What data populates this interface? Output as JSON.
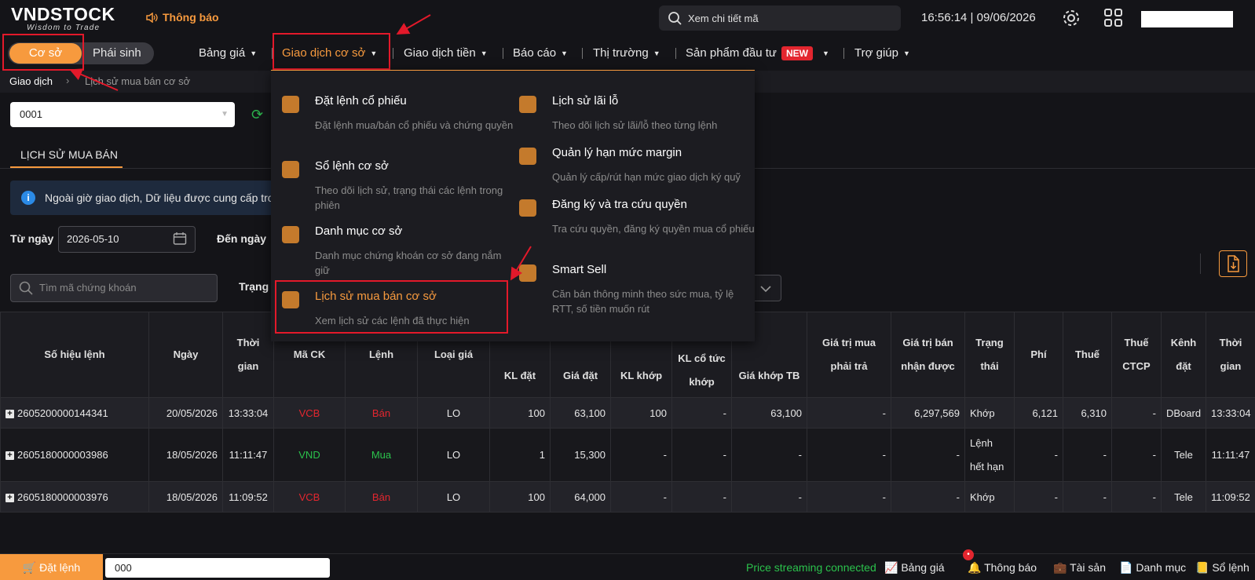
{
  "header": {
    "logo": "VNDSTOCK",
    "tagline": "Wisdom to Trade",
    "notice": "Thông báo",
    "search_placeholder": "Xem chi tiết mã",
    "clock": "16:56:14 | 09/06/2026"
  },
  "segment": {
    "active": "Cơ sở",
    "other": "Phái sinh"
  },
  "nav": {
    "items": [
      "Bảng giá",
      "Giao dịch cơ sở",
      "Giao dịch tiền",
      "Báo cáo",
      "Thị trường",
      "Sản phẩm đầu tư",
      "Trợ giúp"
    ],
    "new_badge": "NEW"
  },
  "breadcrumb": {
    "root": "Giao dịch",
    "current": "Lịch sử mua bán cơ sở"
  },
  "account": {
    "value": "0001"
  },
  "tab": {
    "label": "LỊCH SỬ MUA BÁN"
  },
  "info": {
    "text": "Ngoài giờ giao dịch, Dữ liệu được cung cấp trong"
  },
  "filters": {
    "from_label": "Từ ngày",
    "from_value": "2026-05-10",
    "to_label": "Đến ngày",
    "search_placeholder": "Tìm mã chứng khoán",
    "status_label": "Trạng t"
  },
  "dropdown": {
    "left": [
      {
        "title": "Đặt lệnh cổ phiếu",
        "desc": "Đặt lệnh mua/bán cổ phiếu và chứng quyền"
      },
      {
        "title": "Sổ lệnh cơ sở",
        "desc": "Theo dõi lịch sử, trạng thái các lệnh trong phiên"
      },
      {
        "title": "Danh mục cơ sở",
        "desc": "Danh mục chứng khoán cơ sở đang nắm giữ"
      },
      {
        "title": "Lịch sử mua bán cơ sở",
        "desc": "Xem lịch sử các lệnh đã thực hiện"
      }
    ],
    "right": [
      {
        "title": "Lịch sử lãi lỗ",
        "desc": "Theo dõi lịch sử lãi/lỗ theo từng lệnh"
      },
      {
        "title": "Quản lý hạn mức margin",
        "desc": "Quản lý cấp/rút hạn mức giao dịch ký quỹ"
      },
      {
        "title": "Đăng ký và tra cứu quyền",
        "desc": "Tra cứu quyền, đăng ký quyền mua cổ phiếu"
      },
      {
        "title": "Smart Sell",
        "desc": "Căn bán thông minh theo sức mua, tỷ lệ RTT, số tiền muốn rút"
      }
    ]
  },
  "table": {
    "headers": {
      "order_no": "Số hiệu lệnh",
      "date": "Ngày",
      "time1": "Thời",
      "time2": "gian",
      "symbol": "Mã CK",
      "side": "Lệnh",
      "price_type": "Loại giá",
      "qty": "KL đặt",
      "price": "Giá đặt",
      "matched_qty": "KL khớp",
      "div1": "KL cổ tức",
      "div2": "khớp",
      "avg": "Giá khớp TB",
      "pay1": "Giá trị mua",
      "pay2": "phải trả",
      "recv1": "Giá trị bán",
      "recv2": "nhận được",
      "status1": "Trạng",
      "status2": "thái",
      "fee": "Phí",
      "tax": "Thuế",
      "ctcp1": "Thuế",
      "ctcp2": "CTCP",
      "channel1": "Kênh",
      "channel2": "đặt",
      "t2_1": "Thời",
      "t2_2": "gian"
    },
    "rows": [
      {
        "order_no": "2605200000144341",
        "date": "20/05/2026",
        "time": "13:33:04",
        "symbol": "VCB",
        "side": "Bán",
        "price_type": "LO",
        "qty": "100",
        "price": "63,100",
        "matched_qty": "100",
        "div": "-",
        "avg": "63,100",
        "pay": "-",
        "recv": "6,297,569",
        "status": "Khớp",
        "fee": "6,121",
        "tax": "6,310",
        "ctcp": "-",
        "channel": "DBoard",
        "time2": "13:33:04"
      },
      {
        "order_no": "2605180000003986",
        "date": "18/05/2026",
        "time": "11:11:47",
        "symbol": "VND",
        "side": "Mua",
        "price_type": "LO",
        "qty": "1",
        "price": "15,300",
        "matched_qty": "-",
        "div": "-",
        "avg": "-",
        "pay": "-",
        "recv": "-",
        "status1": "Lệnh",
        "status2": "hết hạn",
        "fee": "-",
        "tax": "-",
        "ctcp": "-",
        "channel": "Tele",
        "time2": "11:11:47"
      },
      {
        "order_no": "2605180000003976",
        "date": "18/05/2026",
        "time": "11:09:52",
        "symbol": "VCB",
        "side": "Bán",
        "price_type": "LO",
        "qty": "100",
        "price": "64,000",
        "matched_qty": "-",
        "div": "-",
        "avg": "-",
        "pay": "-",
        "recv": "-",
        "status": "Khớp",
        "fee": "-",
        "tax": "-",
        "ctcp": "-",
        "channel": "Tele",
        "time2": "11:09:52"
      }
    ]
  },
  "bottom": {
    "order_button": "Đặt lệnh",
    "order_input": "000",
    "stream_status": "Price streaming connected",
    "price_board": "Bảng giá",
    "notification": "Thông báo",
    "assets": "Tài sản",
    "portfolio": "Danh mục",
    "order_book": "Sổ lệnh"
  },
  "colors": {
    "accent": "#f79a3e",
    "sell": "#e3262f",
    "buy": "#2bc24c",
    "highlight": "#e3192a"
  }
}
